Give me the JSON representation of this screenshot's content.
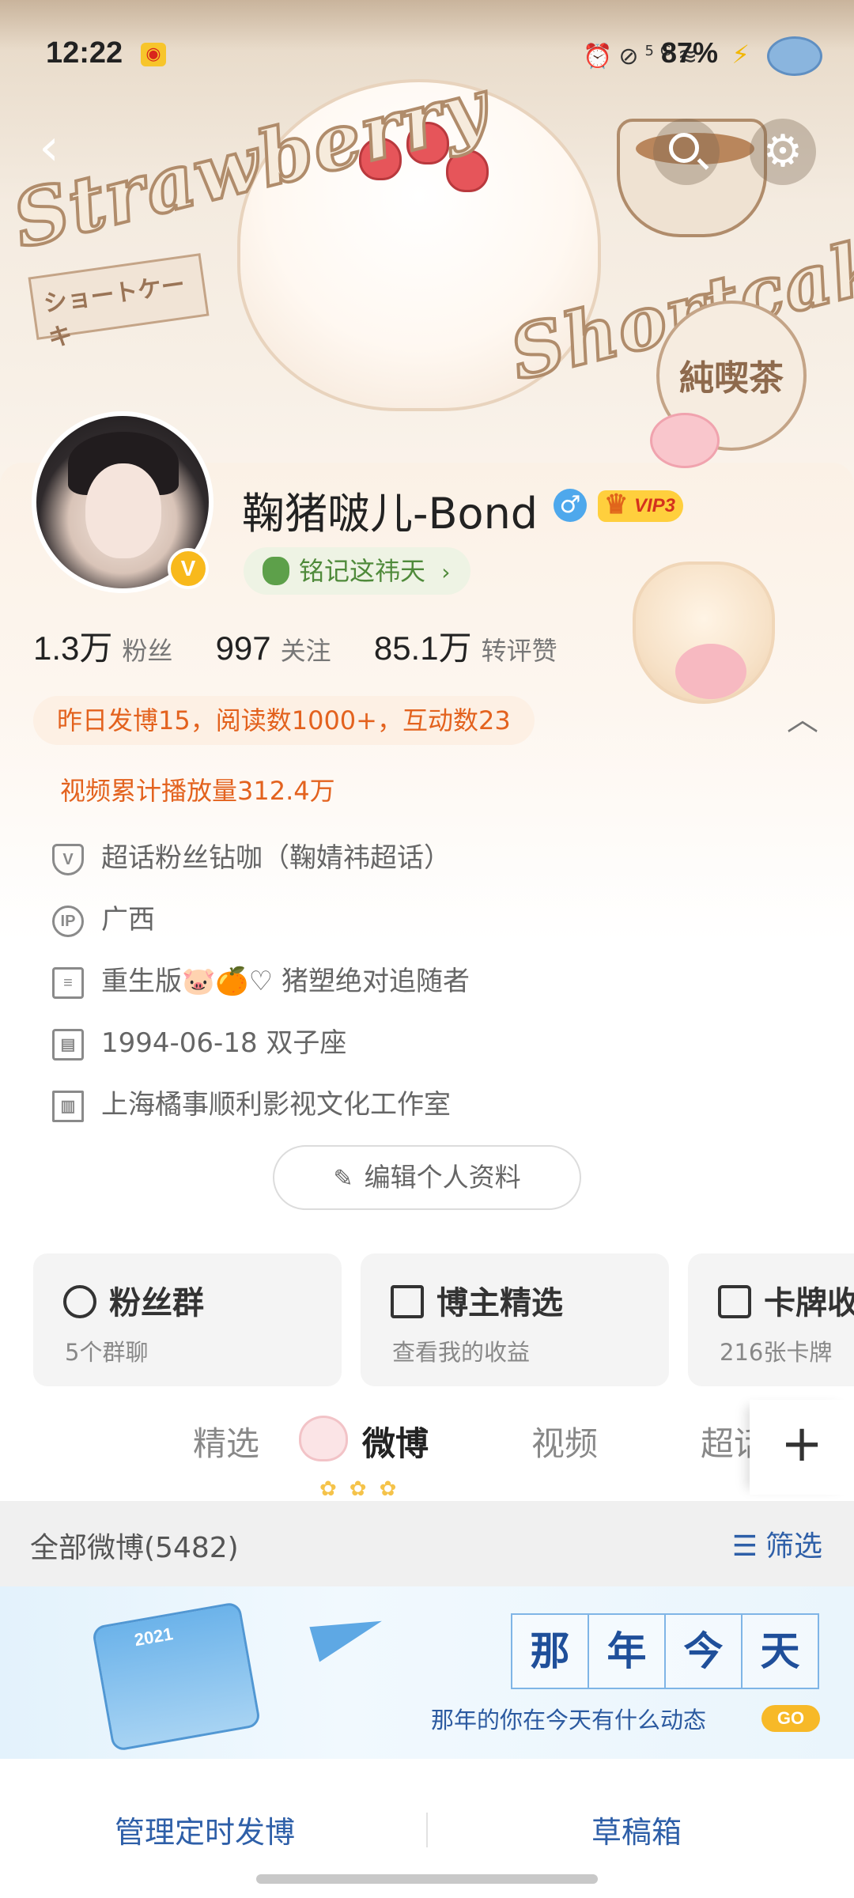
{
  "status_bar": {
    "time": "12:22",
    "network": "5G",
    "battery": "87%",
    "icons": [
      "alarm-icon",
      "mute-icon",
      "signal-5g-icon",
      "wifi-icon"
    ]
  },
  "banner": {
    "title_line1": "Strawberry",
    "title_line2": "Shortcake",
    "jp_label": "ショートケーキ",
    "badge": "純喫茶"
  },
  "profile": {
    "name": "鞠猪啵儿-Bond",
    "gender_symbol": "♂",
    "vip": "VIP3",
    "verified_mark": "V",
    "tagline": "铭记这祎天",
    "tagline_chevron": "›"
  },
  "stats": [
    {
      "value": "1.3万",
      "label": "粉丝"
    },
    {
      "value": "997",
      "label": "关注"
    },
    {
      "value": "85.1万",
      "label": "转评赞"
    }
  ],
  "activity": {
    "summary": "昨日发博15，阅读数1000+，互动数23",
    "video": "视频累计播放量312.4万",
    "collapse_glyph": "︿"
  },
  "info": [
    {
      "icon": "shield-icon",
      "glyph": "V",
      "text": "超话粉丝钻咖（鞠婧祎超话）"
    },
    {
      "icon": "ip-icon",
      "glyph": "IP",
      "text": "广西"
    },
    {
      "icon": "document-icon",
      "glyph": "≡",
      "text": "重生版🐷🍊♡ 猪塑绝对追随者"
    },
    {
      "icon": "calendar-icon",
      "glyph": "▤",
      "text": "1994-06-18 双子座"
    },
    {
      "icon": "building-icon",
      "glyph": "▥",
      "text": "上海橘事顺利影视文化工作室"
    }
  ],
  "edit_profile": {
    "label": "编辑个人资料",
    "icon_glyph": "✎"
  },
  "features": [
    {
      "title": "粉丝群",
      "subtitle": "5个群聊"
    },
    {
      "title": "博主精选",
      "subtitle": "查看我的收益"
    },
    {
      "title": "卡牌收",
      "subtitle": "216张卡牌"
    }
  ],
  "tabs": [
    {
      "label": "精选",
      "active": false
    },
    {
      "label": "微博",
      "active": true
    },
    {
      "label": "视频",
      "active": false
    },
    {
      "label": "超话",
      "active": false
    }
  ],
  "tab_add": "+",
  "tab_dots": "✿✿✿",
  "filter": {
    "label": "全部微博(5482)",
    "button": "筛选",
    "button_icon": "☰"
  },
  "on_this_day": {
    "title_chars": [
      "那",
      "年",
      "今",
      "天"
    ],
    "subtitle": "那年的你在今天有什么动态",
    "go": "GO",
    "calendar_year": "2021"
  },
  "bottom": {
    "left": "管理定时发博",
    "right": "草稿箱"
  },
  "colors": {
    "accent_orange": "#e3621e",
    "link_blue": "#2e5fa8",
    "vip_gold": "#ffcf3d",
    "tagline_green": "#4f8a3a"
  }
}
